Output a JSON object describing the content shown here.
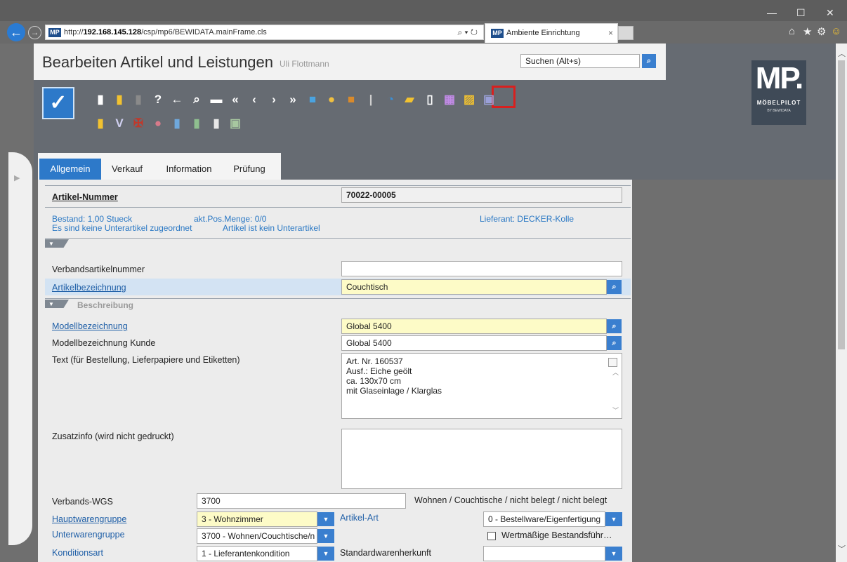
{
  "browser": {
    "url_prefix": "http://",
    "url_host": "192.168.145.128",
    "url_path": "/csp/mp6/BEWIDATA.mainFrame.cls",
    "address_controls": "⌕ ▾ ↻",
    "tab_title": "Ambiente Einrichtung",
    "favicon_text": "MP",
    "window_controls": [
      "—",
      "☐",
      "✕"
    ],
    "toolbar_icons": [
      "⌂",
      "★",
      "⚙",
      "☺"
    ]
  },
  "app": {
    "title": "Bearbeiten Artikel und Leistungen",
    "user": "Uli Flottmann",
    "search_placeholder": "Suchen (Alt+s)",
    "logo": {
      "main": "MP.",
      "line1": "MÖBELPILOT",
      "line2": "BY BEWIDATA"
    }
  },
  "toolbar": {
    "save_icon": "✓",
    "row1": [
      {
        "name": "new-icon",
        "glyph": "▮",
        "color": "#ffffff"
      },
      {
        "name": "open-icon",
        "glyph": "▮",
        "color": "#f2c230"
      },
      {
        "name": "delete-icon",
        "glyph": "▮",
        "color": "#8a8a8a"
      },
      {
        "name": "help-icon",
        "glyph": "?",
        "color": "#ffffff"
      },
      {
        "name": "back-icon",
        "glyph": "←",
        "color": "#ffffff"
      },
      {
        "name": "search-icon",
        "glyph": "⌕",
        "color": "#ffffff"
      },
      {
        "name": "print-icon",
        "glyph": "▬",
        "color": "#ffffff"
      },
      {
        "name": "first-icon",
        "glyph": "«",
        "color": "#ffffff"
      },
      {
        "name": "prev-icon",
        "glyph": "‹",
        "color": "#ffffff"
      },
      {
        "name": "next-icon",
        "glyph": "›",
        "color": "#ffffff"
      },
      {
        "name": "last-icon",
        "glyph": "»",
        "color": "#ffffff"
      },
      {
        "name": "articles-icon",
        "glyph": "■",
        "color": "#4aa3e0"
      },
      {
        "name": "coins-icon",
        "glyph": "●",
        "color": "#f0c040"
      },
      {
        "name": "box-icon",
        "glyph": "■",
        "color": "#d98a2b"
      },
      {
        "name": "screw-icon",
        "glyph": "|",
        "color": "#cfcfcf"
      },
      {
        "name": "pie-icon",
        "glyph": "◔",
        "color": "#3a8fd6"
      },
      {
        "name": "tape-icon",
        "glyph": "▰",
        "color": "#f2c230"
      },
      {
        "name": "doc-add-icon",
        "glyph": "▯",
        "color": "#ffffff"
      },
      {
        "name": "calendar-icon",
        "glyph": "▦",
        "color": "#c38be8"
      },
      {
        "name": "note-icon",
        "glyph": "▨",
        "color": "#f2c230"
      },
      {
        "name": "calendar-30-icon",
        "glyph": "▣",
        "color": "#9aa0d8"
      }
    ],
    "row2": [
      {
        "name": "folder-tool-icon",
        "glyph": "▮",
        "color": "#f2c230"
      },
      {
        "name": "v-icon",
        "glyph": "V",
        "color": "#d0d0f0"
      },
      {
        "name": "flag-icon",
        "glyph": "✠",
        "color": "#c0392b"
      },
      {
        "name": "ball-icon",
        "glyph": "●",
        "color": "#d77a8a"
      },
      {
        "name": "folder-blue-icon",
        "glyph": "▮",
        "color": "#6fa8dc"
      },
      {
        "name": "folder-green-icon",
        "glyph": "▮",
        "color": "#8fbf8f"
      },
      {
        "name": "doc-hand-icon",
        "glyph": "▮",
        "color": "#e8e8e8"
      },
      {
        "name": "translate-icon",
        "glyph": "▣",
        "color": "#a7c7a0"
      }
    ]
  },
  "tabs": [
    "Allgemein",
    "Verkauf",
    "Information",
    "Prüfung"
  ],
  "form": {
    "artikel_nummer": {
      "label": "Artikel-Nummer",
      "value": "70022-00005"
    },
    "info": {
      "bestand": "Bestand: 1,00 Stueck",
      "pos_menge": "akt.Pos.Menge: 0/0",
      "lieferant": "Lieferant: DECKER-Kolle",
      "keine_unterartikel": "Es sind keine Unterartikel zugeordnet",
      "kein_unterartikel": "Artikel ist kein Unterartikel"
    },
    "verbandsartikelnummer": {
      "label": "Verbandsartikelnummer",
      "value": ""
    },
    "artikelbezeichnung": {
      "label": "Artikelbezeichnung",
      "value": "Couchtisch"
    },
    "beschreibung_title": "Beschreibung",
    "modellbezeichnung": {
      "label": "Modellbezeichnung",
      "value": "Global 5400"
    },
    "modellbezeichnung_kunde": {
      "label": "Modellbezeichnung Kunde",
      "value": "Global 5400"
    },
    "text": {
      "label": "Text (für Bestellung, Lieferpapiere und Etiketten)",
      "lines": [
        "Art. Nr. 160537",
        "Ausf.: Eiche geölt",
        "ca. 130x70 cm",
        "mit Glaseinlage / Klarglas"
      ]
    },
    "zusatzinfo": {
      "label": "Zusatzinfo (wird nicht gedruckt)",
      "value": ""
    },
    "verbands_wgs": {
      "label": "Verbands-WGS",
      "value": "3700",
      "desc": "Wohnen / Couchtische / nicht belegt / nicht belegt"
    },
    "hauptwarengruppe": {
      "label": "Hauptwarengruppe",
      "value": "3 - Wohnzimmer"
    },
    "artikel_art": {
      "label": "Artikel-Art",
      "value": "0 - Bestellware/Eigenfertigung"
    },
    "unterwarengruppe": {
      "label": "Unterwarengruppe",
      "value": "3700 - Wohnen/Couchtische/n"
    },
    "wertmaessige": {
      "label": "Wertmäßige Bestandsführ…",
      "checked": false
    },
    "konditionsart": {
      "label": "Konditionsart",
      "value": "1 - Lieferantenkondition"
    },
    "standardwarenherkunft": {
      "label": "Standardwarenherkunft",
      "value": ""
    }
  }
}
